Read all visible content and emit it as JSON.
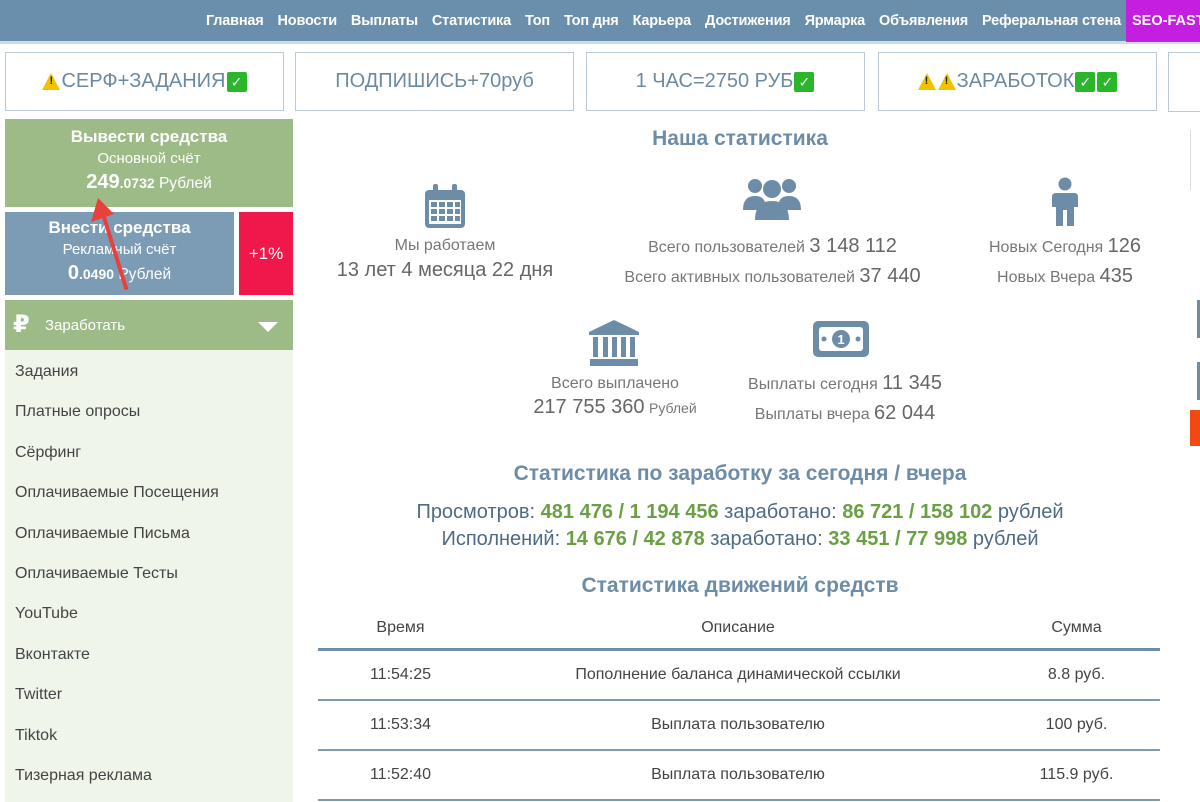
{
  "topnav": {
    "items": [
      "Главная",
      "Новости",
      "Выплаты",
      "Статистика",
      "Топ",
      "Топ дня",
      "Карьера",
      "Достижения",
      "Ярмарка",
      "Объявления",
      "Реферальная стена"
    ],
    "promo": "SEO-FAST"
  },
  "banners": [
    {
      "text": "СЕРФ+ЗАДАНИЯ",
      "icons_before": [
        "warning-icon"
      ],
      "icons_after": [
        "check-icon"
      ]
    },
    {
      "text": "ПОДПИШИСЬ+70руб",
      "icons_before": [],
      "icons_after": []
    },
    {
      "text": "1 ЧАС=2750 РУБ",
      "icons_before": [],
      "icons_after": [
        "check-icon"
      ]
    },
    {
      "text": "ЗАРАБОТОК",
      "icons_before": [
        "warning-icon",
        "warning-icon"
      ],
      "icons_after": [
        "check-icon",
        "check-icon"
      ]
    }
  ],
  "account": {
    "withdraw_title": "Вывести средства",
    "withdraw_sub": "Основной счёт",
    "withdraw_big": "249",
    "withdraw_small": ".0732",
    "withdraw_currency": "Рублей",
    "deposit_title": "Внести средства",
    "deposit_sub": "Рекламный счёт",
    "deposit_big": "0",
    "deposit_small": ".0490",
    "deposit_currency": "Рублей",
    "bonus": "+1%"
  },
  "earn_menu": {
    "symbol": "₽",
    "label": "Заработать",
    "items": [
      "Задания",
      "Платные опросы",
      "Сёрфинг",
      "Оплачиваемые Посещения",
      "Оплачиваемые Письма",
      "Оплачиваемые Тесты",
      "YouTube",
      "Вконтакте",
      "Twitter",
      "Tiktok",
      "Тизерная реклама"
    ]
  },
  "stats": {
    "title": "Наша статистика",
    "working_label": "Мы работаем",
    "working_value": "13 лет 4 месяца 22 дня",
    "users_total_label": "Всего пользователей",
    "users_total_value": "3 148 112",
    "users_active_label": "Всего активных пользователей",
    "users_active_value": "37 440",
    "new_today_label": "Новых Сегодня",
    "new_today_value": "126",
    "new_yesterday_label": "Новых Вчера",
    "new_yesterday_value": "435",
    "paid_total_label": "Всего выплачено",
    "paid_total_value": "217 755 360",
    "paid_total_unit": "Рублей",
    "pay_today_label": "Выплаты сегодня",
    "pay_today_value": "11 345",
    "pay_yesterday_label": "Выплаты вчера",
    "pay_yesterday_value": "62 044"
  },
  "earnings": {
    "title": "Статистика по заработку за сегодня / вчера",
    "views_label": "Просмотров:",
    "views_value": "481 476 / 1 194 456",
    "earned_label": "заработано:",
    "views_earned": "86 721 / 158 102",
    "currency": "рублей",
    "exec_label": "Исполнений:",
    "exec_value": "14 676 / 42 878",
    "exec_earned": "33 451 / 77 998"
  },
  "movements": {
    "title": "Статистика движений средств",
    "headers": [
      "Время",
      "Описание",
      "Сумма"
    ],
    "rows": [
      {
        "time": "11:54:25",
        "desc": "Пополнение баланса динамической ссылки",
        "sum": "8.8 руб."
      },
      {
        "time": "11:53:34",
        "desc": "Выплата пользователю",
        "sum": "100 руб."
      },
      {
        "time": "11:52:40",
        "desc": "Выплата пользователю",
        "sum": "115.9 руб."
      }
    ]
  }
}
